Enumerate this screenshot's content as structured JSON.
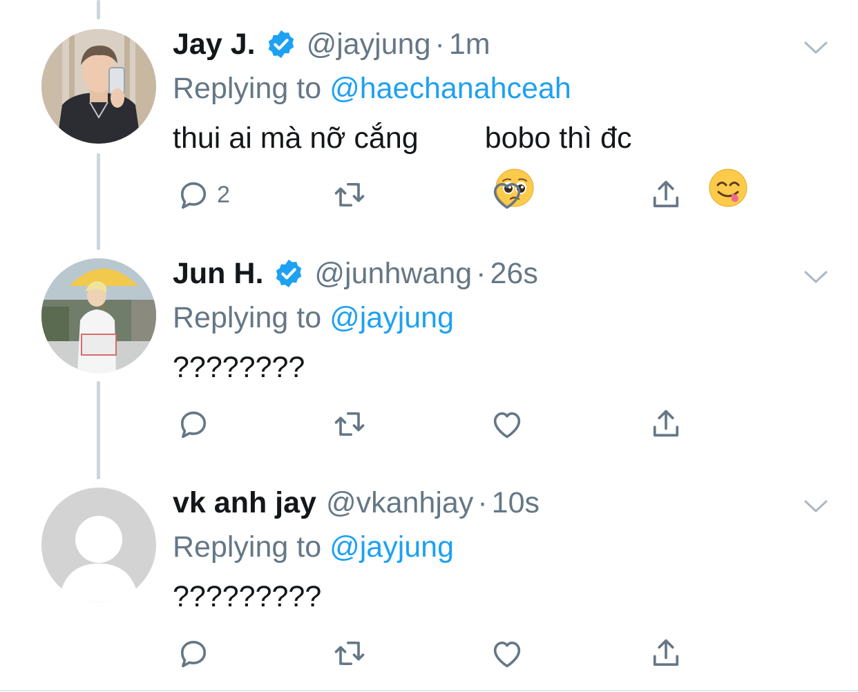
{
  "colors": {
    "accent": "#1da1f2",
    "secondary_text": "#657786",
    "thread_line": "#ccd6dd",
    "icon": "#657786"
  },
  "tweets": [
    {
      "name": "Jay J.",
      "verified": true,
      "handle": "@jayjung",
      "dot": "·",
      "time": "1m",
      "replying_prefix": "Replying to ",
      "replying_to": "@haechanahceah",
      "text_part1": "thui ai mà nỡ cắng",
      "emoji1": "pleading-face",
      "text_part2": "bobo thì đc",
      "emoji2": "yum-face",
      "reply_count": "2",
      "avatar": "photo-of-person-with-phone"
    },
    {
      "name": "Jun H.",
      "verified": true,
      "handle": "@junhwang",
      "dot": "·",
      "time": "26s",
      "replying_prefix": "Replying to ",
      "replying_to": "@jayjung",
      "text": "????????",
      "reply_count": "",
      "avatar": "photo-of-person-outdoors"
    },
    {
      "name": "vk anh jay",
      "verified": false,
      "handle": "@vkanhjay",
      "dot": "·",
      "time": "10s",
      "replying_prefix": "Replying to ",
      "replying_to": "@jayjung",
      "text": "?????????",
      "reply_count": "",
      "avatar": "default-avatar"
    }
  ],
  "icons": [
    "reply-icon",
    "retweet-icon",
    "like-icon",
    "share-icon",
    "chevron-down-icon",
    "verified-badge-icon"
  ]
}
